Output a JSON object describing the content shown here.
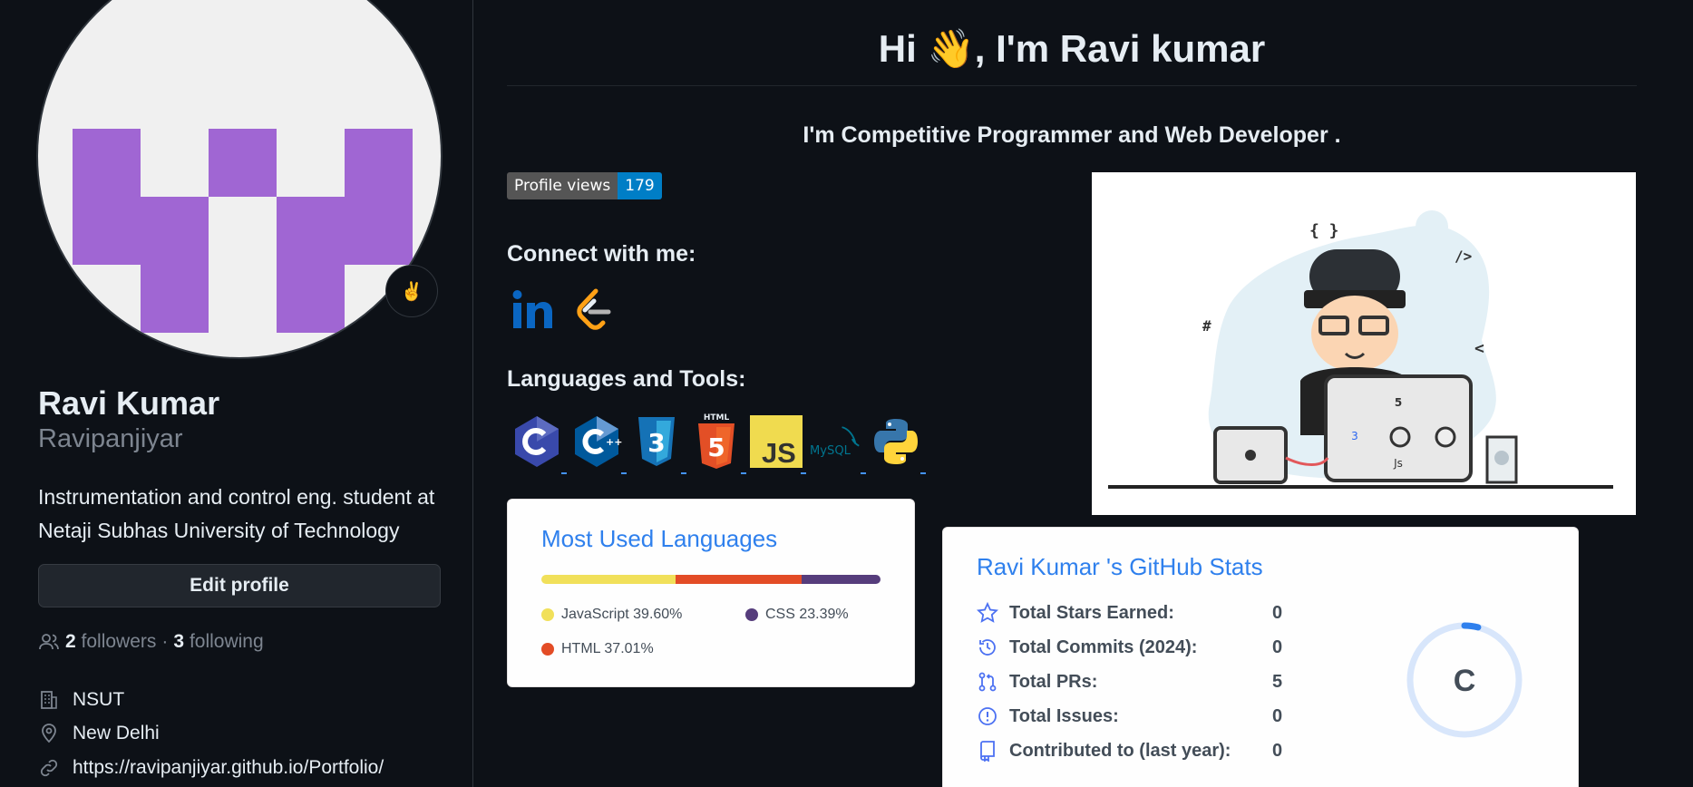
{
  "profile": {
    "name": "Ravi Kumar",
    "username": "Ravipanjiyar",
    "bio": "Instrumentation and control eng. student at Netaji Subhas University of Technology",
    "status_emoji": "✌️",
    "edit_button": "Edit profile",
    "followers_count": "2",
    "followers_label": "followers",
    "separator": "·",
    "following_count": "3",
    "following_label": "following",
    "organization": "NSUT",
    "location": "New Delhi",
    "website": "https://ravipanjiyar.github.io/Portfolio/"
  },
  "readme": {
    "title": "Hi 👋, I'm Ravi kumar",
    "subtitle": "I'm Competitive Programmer and Web Developer .",
    "badge_label": "Profile views",
    "badge_value": "179",
    "connect_heading": "Connect with me:",
    "languages_heading": "Languages and Tools:",
    "social_icons": [
      "linkedin-icon",
      "leetcode-icon"
    ],
    "tool_icons": [
      "c-icon",
      "cplusplus-icon",
      "css3-icon",
      "html5-icon",
      "javascript-icon",
      "mysql-icon",
      "python-icon"
    ],
    "tool_labels": {
      "html": "HTML",
      "js": "JS",
      "mysql": "MySQL"
    }
  },
  "hero": {
    "code_labels": [
      "{ }",
      "/>",
      "#",
      "<"
    ],
    "laptop_labels": [
      "5",
      "3",
      "Js"
    ]
  },
  "languages_card": {
    "title": "Most Used Languages",
    "items": [
      {
        "name": "JavaScript",
        "percent": 39.6,
        "label": "JavaScript 39.60%",
        "color": "#f1e05a"
      },
      {
        "name": "HTML",
        "percent": 37.01,
        "label": "HTML 37.01%",
        "color": "#e34c26"
      },
      {
        "name": "CSS",
        "percent": 23.39,
        "label": "CSS 23.39%",
        "color": "#563d7c"
      }
    ]
  },
  "stats_card": {
    "title": "Ravi Kumar 's GitHub Stats",
    "rows": [
      {
        "label": "Total Stars Earned:",
        "value": "0",
        "icon": "star-icon"
      },
      {
        "label": "Total Commits (2024):",
        "value": "0",
        "icon": "history-icon"
      },
      {
        "label": "Total PRs:",
        "value": "5",
        "icon": "pull-request-icon"
      },
      {
        "label": "Total Issues:",
        "value": "0",
        "icon": "issue-icon"
      },
      {
        "label": "Contributed to (last year):",
        "value": "0",
        "icon": "repo-icon"
      }
    ],
    "rank": "C",
    "rank_progress": 0.04
  },
  "colors": {
    "background": "#0d1117",
    "accent_blue": "#2f80ed",
    "avatar_purple": "#a066d3",
    "badge_blue": "#007ec6"
  }
}
